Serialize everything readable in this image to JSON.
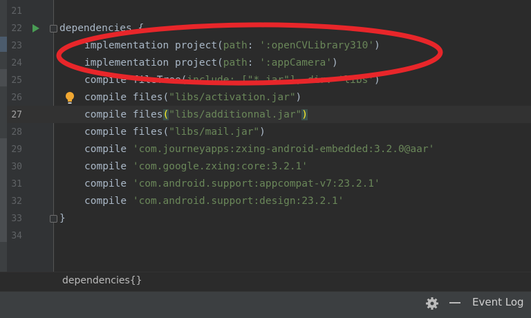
{
  "gutter": {
    "line_numbers": [
      "21",
      "22",
      "23",
      "24",
      "25",
      "26",
      "27",
      "28",
      "29",
      "30",
      "31",
      "32",
      "33",
      "34"
    ]
  },
  "code": {
    "line21": "",
    "line22_kw": "dependencies {",
    "line23_a": "implementation project(",
    "line23_p": "path",
    "line23_c": ": ",
    "line23_s": "':openCVLibrary310'",
    "line23_e": ")",
    "line24_a": "implementation project(",
    "line24_p": "path",
    "line24_c": ": ",
    "line24_s": "':appCamera'",
    "line24_e": ")",
    "line25_a": "compile fileTree(",
    "line25_p": "include",
    "line25_s": ": [\"*.jar\"], dir: 'libs'",
    "line25_e": ")",
    "line26_a": "compile files(",
    "line26_s": "\"libs/activation.jar\"",
    "line26_e": ")",
    "line27_a": "compile files",
    "line27_o": "(",
    "line27_s": "\"libs/additionnal.jar\"",
    "line27_e": ")",
    "line28_a": "compile files(",
    "line28_s": "\"libs/mail.jar\"",
    "line28_e": ")",
    "line29_a": "compile ",
    "line29_s": "'com.journeyapps:zxing-android-embedded:3.2.0@aar'",
    "line30_a": "compile ",
    "line30_s": "'com.google.zxing:core:3.2.1'",
    "line31_a": "compile ",
    "line31_s": "'com.android.support:appcompat-v7:23.2.1'",
    "line32_a": "compile ",
    "line32_s": "'com.android.support:design:23.2.1'",
    "line33": "}"
  },
  "breadcrumb": "dependencies{}",
  "status": {
    "settings_icon": "gear-icon",
    "minimize_icon": "minimize-icon",
    "event_log": "Event Log"
  },
  "colors": {
    "annotation_red": "#e8262a",
    "string_green": "#6a8759",
    "run_green": "#499c54"
  }
}
